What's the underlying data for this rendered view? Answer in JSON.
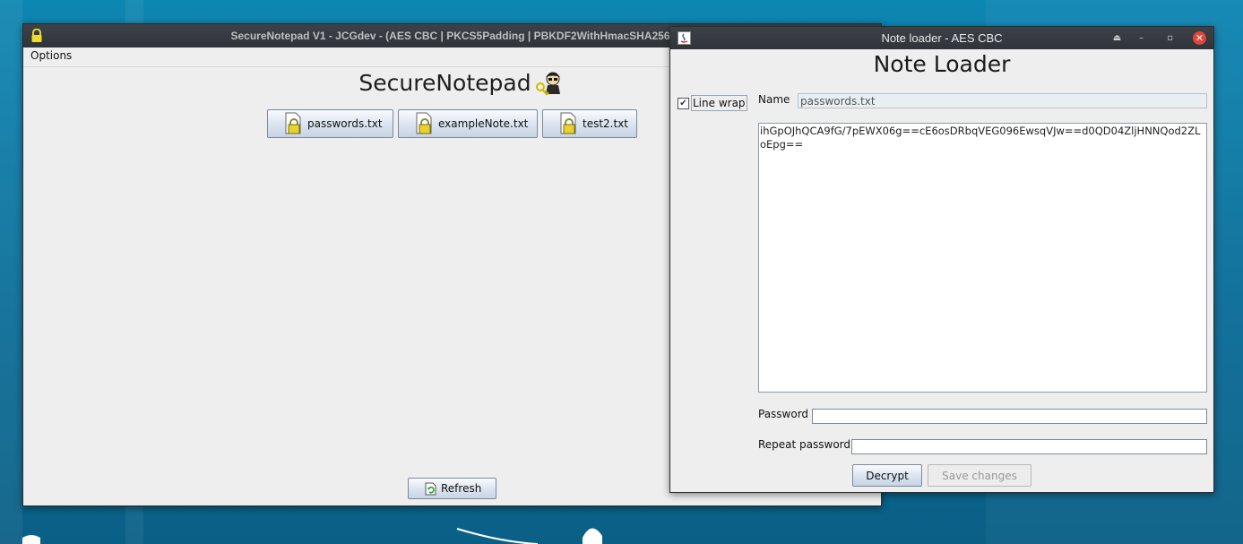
{
  "main_window": {
    "title": "SecureNotepad V1 - JCGdev - (AES CBC | PKCS5Padding | PBKDF2WithHmacSHA256)",
    "menu": [
      "Options"
    ],
    "heading": "SecureNotepad",
    "notes": [
      {
        "label": "passwords.txt",
        "icon": "lock-file-icon"
      },
      {
        "label": "exampleNote.txt",
        "icon": "lock-file-icon"
      },
      {
        "label": "test2.txt",
        "icon": "lock-file-icon"
      }
    ],
    "refresh_label": "Refresh"
  },
  "loader_window": {
    "title": "Note loader - AES CBC",
    "heading": "Note Loader",
    "line_wrap_label": "Line wrap",
    "line_wrap_checked": true,
    "name_label": "Name",
    "name_value": "passwords.txt",
    "ciphertext": "ihGpOJhQCA9fG/7pEWX06g==cE6osDRbqVEG096EwsqVJw==d0QD04ZljHNNQod2ZLoEpg==",
    "password_label": "Password",
    "repeat_password_label": "Repeat password",
    "decrypt_label": "Decrypt",
    "save_label": "Save changes"
  },
  "colors": {
    "desktop": "#0a6d98",
    "titlebar": "#33373d",
    "window_bg": "#eeeeee",
    "close": "#e0453a"
  }
}
